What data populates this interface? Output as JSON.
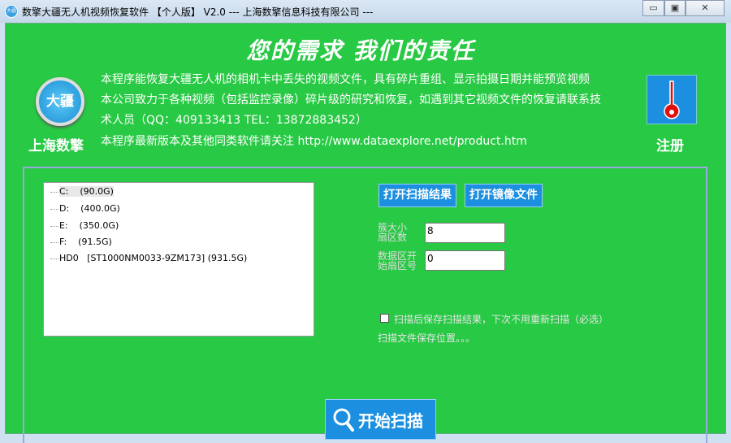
{
  "window": {
    "title": "数擎大疆无人机视频恢复软件 【个人版】 V2.0 --- 上海数擎信息科技有限公司 ---",
    "icon_text": "大疆",
    "minimize": "▭",
    "maximize": "▣",
    "close": "✕"
  },
  "header": {
    "slogan": "您的需求  我们的责任",
    "logo_text": "大疆",
    "company": "上海数擎",
    "lines": [
      "本程序能恢复大疆无人机的相机卡中丢失的视频文件，具有碎片重组、显示拍摄日期并能预览视频",
      "本公司致力于各种视频（包括监控录像）碎片级的研究和恢复，如遇到其它视频文件的恢复请联系技",
      "术人员（QQ：409133413  TEL：13872883452）",
      "本程序最新版本及其他同类软件请关注 http://www.dataexplore.net/product.htm"
    ],
    "register": "注册"
  },
  "drives": [
    {
      "label": "C:    (90.0G)"
    },
    {
      "label": "D:    (400.0G)"
    },
    {
      "label": "E:    (350.0G)"
    },
    {
      "label": "F:    (91.5G)"
    },
    {
      "label": "HD0   [ST1000NM0033-9ZM173] (931.5G)"
    }
  ],
  "buttons": {
    "open_scan_result": "打开扫描结果",
    "open_image_file": "打开镜像文件",
    "start_scan": "开始扫描"
  },
  "fields": {
    "cluster_label": "簇大小扇区数",
    "cluster_value": "8",
    "data_start_label": "数据区开始扇区号",
    "data_start_value": "0"
  },
  "options": {
    "save_scan_label": "扫描后保存扫描结果，下次不用重新扫描（必选）",
    "save_scan_checked": false,
    "save_location": "扫描文件保存位置。。。"
  }
}
